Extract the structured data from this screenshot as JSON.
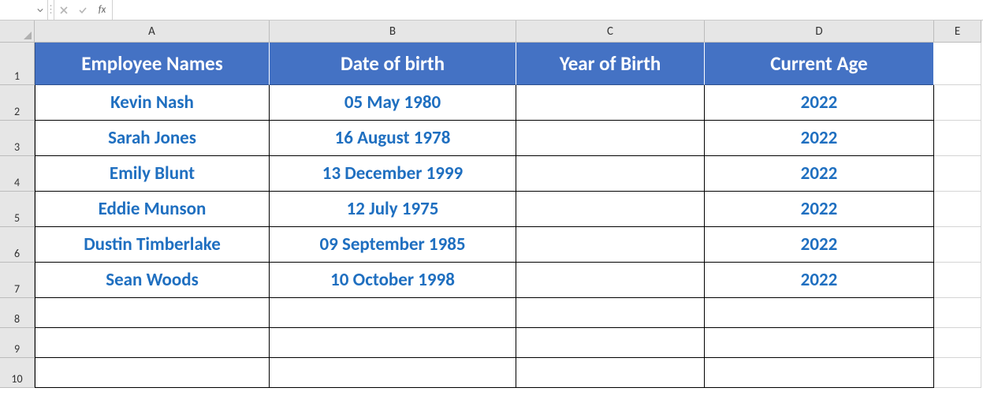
{
  "formula_bar": {
    "name_box": "",
    "formula": ""
  },
  "fx_label": "fx",
  "columns": [
    "A",
    "B",
    "C",
    "D",
    "E"
  ],
  "row_numbers": [
    1,
    2,
    3,
    4,
    5,
    6,
    7,
    8,
    9,
    10
  ],
  "table": {
    "headers": {
      "A": "Employee Names",
      "B": "Date of birth",
      "C": "Year of Birth",
      "D": "Current Age"
    },
    "rows": [
      {
        "name": "Kevin Nash",
        "dob": "05 May 1980",
        "yob": "",
        "age": "2022"
      },
      {
        "name": "Sarah Jones",
        "dob": "16 August 1978",
        "yob": "",
        "age": "2022"
      },
      {
        "name": "Emily Blunt",
        "dob": "13 December 1999",
        "yob": "",
        "age": "2022"
      },
      {
        "name": "Eddie Munson",
        "dob": "12 July 1975",
        "yob": "",
        "age": "2022"
      },
      {
        "name": "Dustin Timberlake",
        "dob": "09 September 1985",
        "yob": "",
        "age": "2022"
      },
      {
        "name": "Sean Woods",
        "dob": "10 October 1998",
        "yob": "",
        "age": "2022"
      }
    ]
  }
}
